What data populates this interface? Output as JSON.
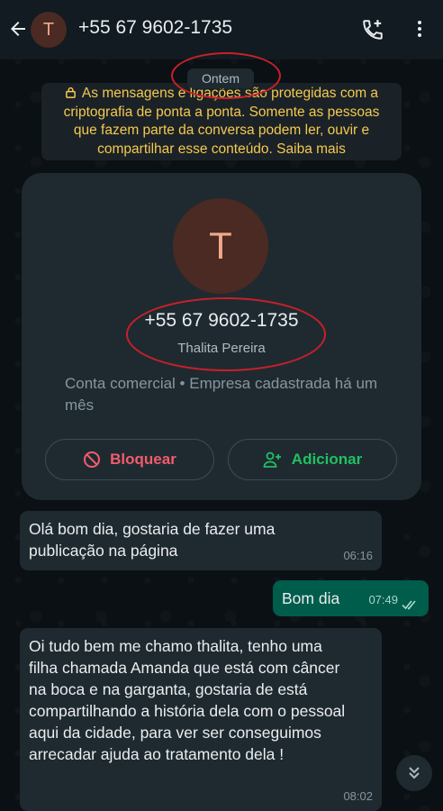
{
  "header": {
    "avatar_letter": "T",
    "title": "+55 67 9602-1735"
  },
  "chat": {
    "date_chip": "Ontem",
    "encryption_notice": "As mensagens e ligações são protegidas com a criptografia de ponta a ponta. Somente as pessoas que fazem parte da conversa podem ler, ouvir e compartilhar esse conteúdo. Saiba mais"
  },
  "profile_card": {
    "avatar_letter": "T",
    "phone": "+55 67 9602-1735",
    "name": "Thalita Pereira",
    "business_info": "Conta comercial • Empresa cadastrada há um mês",
    "block_label": "Bloquear",
    "add_label": "Adicionar"
  },
  "messages": [
    {
      "direction": "incoming",
      "text": "Olá bom dia, gostaria de fazer uma publicação na página",
      "time": "06:16"
    },
    {
      "direction": "outgoing",
      "text": "Bom dia",
      "time": "07:49",
      "status": "read"
    },
    {
      "direction": "incoming",
      "text": "Oi tudo bem me chamo thalita, tenho uma filha chamada Amanda que está com câncer na boca e na garganta, gostaria de está compartilhando a história dela com o pessoal aqui da cidade, para ver ser conseguimos arrecadar ajuda ao tratamento dela !",
      "time": "08:02"
    }
  ],
  "colors": {
    "header_bg": "#111b21",
    "bubble_incoming": "#1f2a30",
    "bubble_outgoing": "#005c4b",
    "notice_text": "#f5c94f",
    "block_red": "#f15c6d",
    "add_green": "#21c063",
    "annotation_red": "#c8202a"
  },
  "icons": [
    "back-arrow-icon",
    "call-add-icon",
    "more-vert-icon",
    "lock-icon",
    "block-icon",
    "person-add-icon",
    "double-check-icon",
    "chevrons-down-icon"
  ]
}
